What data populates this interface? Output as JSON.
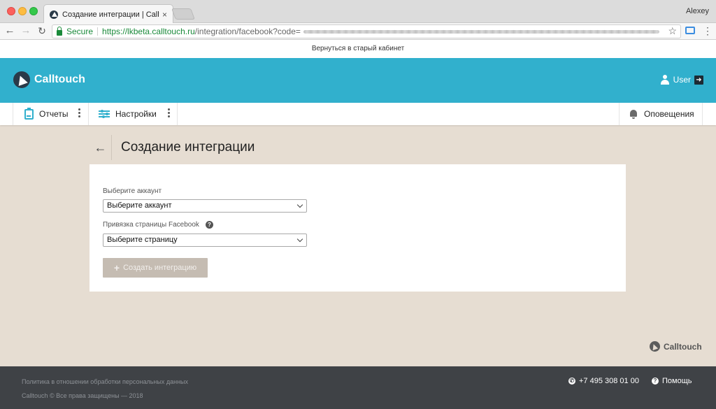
{
  "browser": {
    "tab_title": "Создание интеграции | Calltouch",
    "tab_close": "×",
    "profile_name": "Alexey",
    "back": "←",
    "forward": "→",
    "reload": "↻",
    "secure_label": "Secure",
    "url_host": "https://lkbeta.calltouch.ru",
    "url_path": "/integration/facebook?code=",
    "star": "☆",
    "menu": "⋮"
  },
  "banner": {
    "text": "Вернуться в старый кабинет"
  },
  "header": {
    "brand": "Calltouch",
    "user_label": "User",
    "logout_glyph": "➜",
    "brand_color": "#31b0cd"
  },
  "nav": {
    "reports_label": "Отчеты",
    "settings_label": "Настройки",
    "notifications_label": "Оповещения"
  },
  "page": {
    "back_arrow": "←",
    "title": "Создание интеграции"
  },
  "form": {
    "account_label": "Выберите аккаунт",
    "account_value": "Выберите аккаунт",
    "page_label": "Привязка страницы Facebook",
    "page_value": "Выберите страницу",
    "help_glyph": "?",
    "create_plus": "+",
    "create_label": "Создать интеграцию"
  },
  "footer": {
    "brand": "Calltouch",
    "privacy_link": "Политика в отношении обработки персональных данных",
    "copyright": "Calltouch © Все права защищены — 2018",
    "phone": "+7 495 308 01 00",
    "phone_icon": "✆",
    "help_label": "Помощь",
    "help_icon": "?"
  }
}
